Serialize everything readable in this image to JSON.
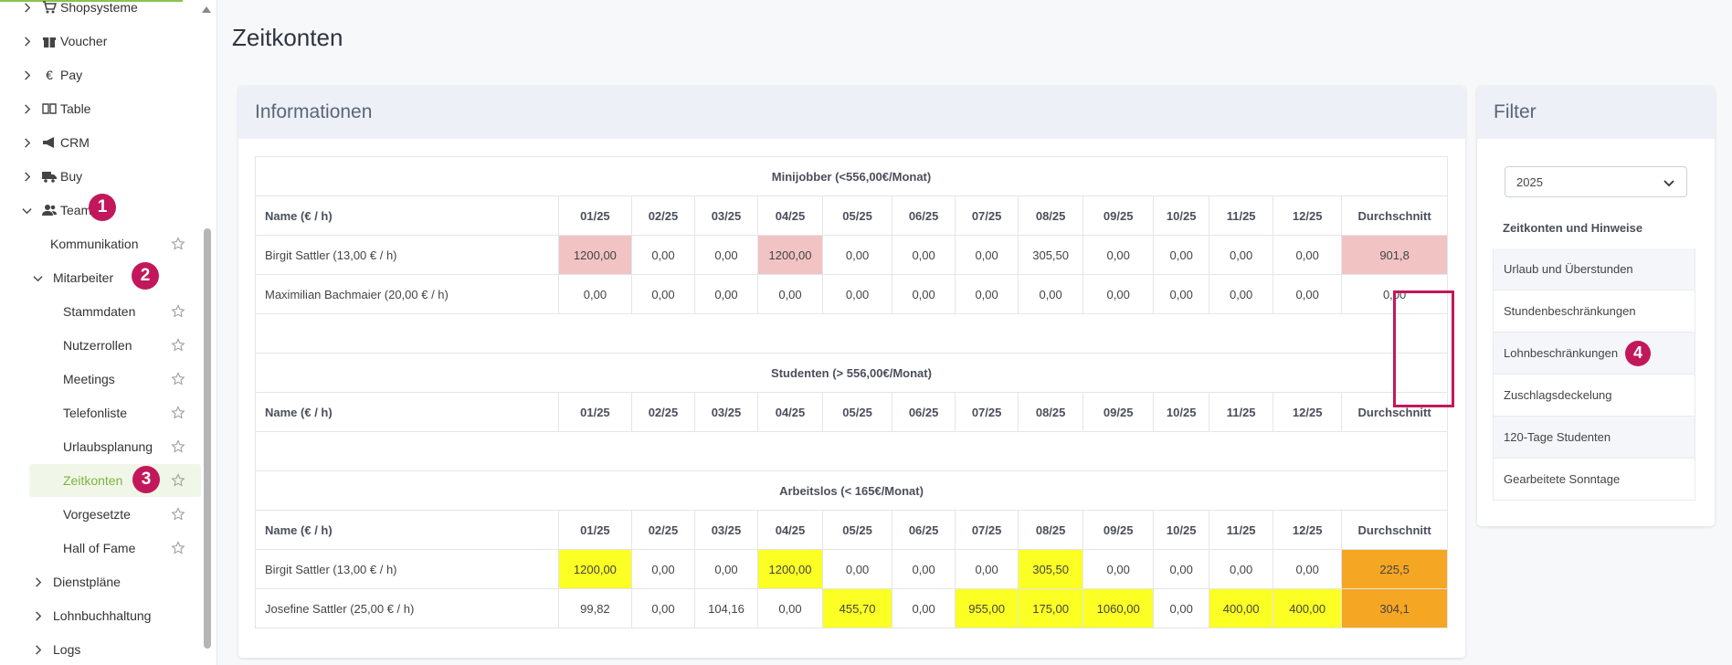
{
  "sidebar": {
    "top_items": [
      {
        "label": "Shopsysteme",
        "icon": "cart-icon"
      },
      {
        "label": "Voucher",
        "icon": "gift-icon"
      },
      {
        "label": "Pay",
        "icon": "euro-icon"
      },
      {
        "label": "Table",
        "icon": "book-icon"
      },
      {
        "label": "CRM",
        "icon": "megaphone-icon"
      },
      {
        "label": "Buy",
        "icon": "truck-icon"
      },
      {
        "label": "Team",
        "icon": "users-icon"
      }
    ],
    "kommunikation": "Kommunikation",
    "mitarbeiter": "Mitarbeiter",
    "sub_items": [
      "Stammdaten",
      "Nutzerrollen",
      "Meetings",
      "Telefonliste",
      "Urlaubsplanung",
      "Zeitkonten",
      "Vorgesetzte",
      "Hall of Fame"
    ],
    "bottom_items": [
      "Dienstpläne",
      "Lohnbuchhaltung",
      "Logs"
    ],
    "badges": [
      "1",
      "2",
      "3",
      "4"
    ]
  },
  "page": {
    "title": "Zeitkonten",
    "breadcrumb_fragment": ""
  },
  "info": {
    "title": "Informationen",
    "months": [
      "01/25",
      "02/25",
      "03/25",
      "04/25",
      "05/25",
      "06/25",
      "07/25",
      "08/25",
      "09/25",
      "10/25",
      "11/25",
      "12/25"
    ],
    "name_header": "Name (€ / h)",
    "avg_header": "Durchschnitt",
    "sections": [
      {
        "title": "Minijobber (<556,00€/Monat)",
        "rows": [
          {
            "name": "Birgit Sattler (13,00 € / h)",
            "values": [
              "1200,00",
              "0,00",
              "0,00",
              "1200,00",
              "0,00",
              "0,00",
              "0,00",
              "305,50",
              "0,00",
              "0,00",
              "0,00",
              "0,00"
            ],
            "avg": "901,8"
          },
          {
            "name": "Maximilian Bachmaier (20,00 € / h)",
            "values": [
              "0,00",
              "0,00",
              "0,00",
              "0,00",
              "0,00",
              "0,00",
              "0,00",
              "0,00",
              "0,00",
              "0,00",
              "0,00",
              "0,00"
            ],
            "avg": "0,00"
          }
        ]
      },
      {
        "title": "Studenten (> 556,00€/Monat)",
        "rows": []
      },
      {
        "title": "Arbeitslos (< 165€/Monat)",
        "rows": [
          {
            "name": "Birgit Sattler (13,00 € / h)",
            "values": [
              "1200,00",
              "0,00",
              "0,00",
              "1200,00",
              "0,00",
              "0,00",
              "0,00",
              "305,50",
              "0,00",
              "0,00",
              "0,00",
              "0,00"
            ],
            "avg": "225,5"
          },
          {
            "name": "Josefine Sattler (25,00 € / h)",
            "values": [
              "99,82",
              "0,00",
              "104,16",
              "0,00",
              "455,70",
              "0,00",
              "955,00",
              "175,00",
              "1060,00",
              "0,00",
              "400,00",
              "400,00"
            ],
            "avg": "304,1"
          }
        ]
      }
    ],
    "colors": {
      "pink": "#f2c3c3",
      "yellow": "#fbff24",
      "orange": "#f5a623",
      "highlight": "#c2185b"
    }
  },
  "filter": {
    "title": "Filter",
    "year": "2025",
    "items": [
      "Zeitkonten und Hinweise",
      "Urlaub und Überstunden",
      "Stundenbeschränkungen",
      "Lohnbeschränkungen",
      "Zuschlagsdeckelung",
      "120-Tage Studenten",
      "Gearbeitete Sonntage"
    ]
  }
}
